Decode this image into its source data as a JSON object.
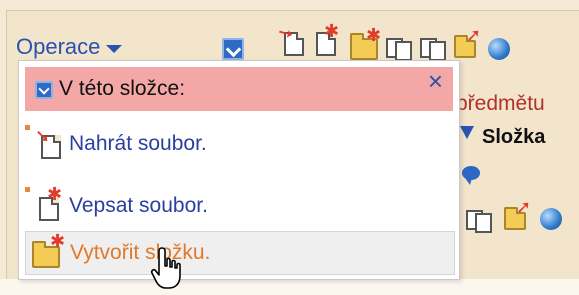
{
  "toolbar": {
    "operations_label": "Operace"
  },
  "background": {
    "subject_text": "předmětu",
    "folder_column_header": "Složka"
  },
  "dropdown": {
    "header_label": "V této složce:",
    "close_symbol": "×",
    "items": [
      {
        "label": "Nahrát soubor."
      },
      {
        "label": "Vepsat soubor."
      },
      {
        "label": "Vytvořit složku."
      }
    ]
  },
  "colors": {
    "link_blue": "#2a52b0",
    "header_pink": "#f4a7a7",
    "hover_orange": "#e07a2a",
    "panel_beige": "#f3e4cc"
  }
}
